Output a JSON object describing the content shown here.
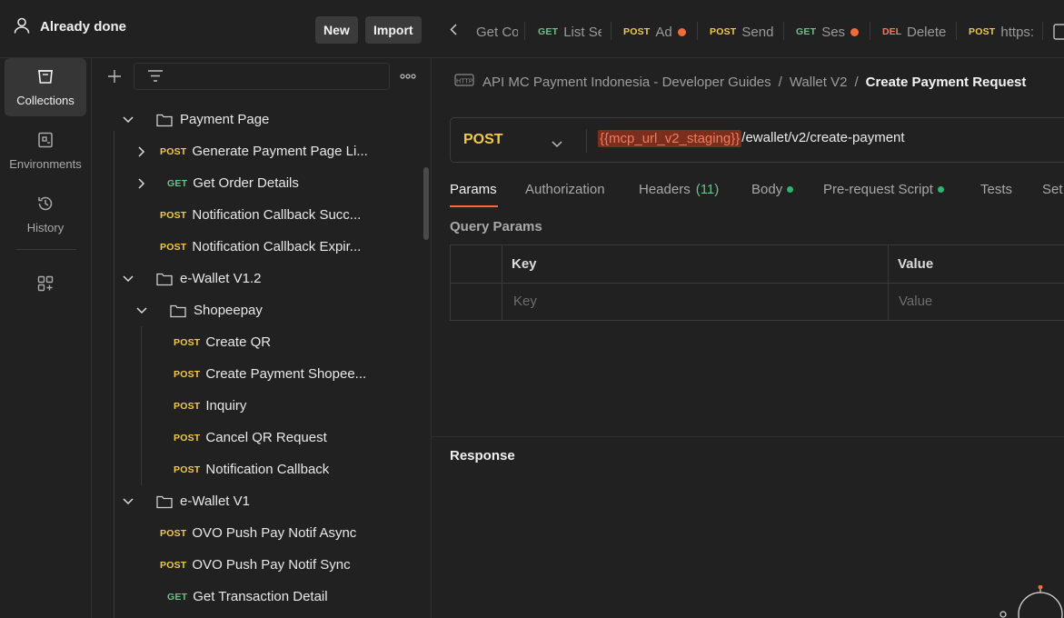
{
  "workspace": {
    "name": "Already done",
    "new_label": "New",
    "import_label": "Import"
  },
  "rail": {
    "items": [
      {
        "label": "Collections",
        "icon": "collections-icon"
      },
      {
        "label": "Environments",
        "icon": "environments-icon"
      },
      {
        "label": "History",
        "icon": "history-icon"
      }
    ]
  },
  "tree": {
    "rows": [
      {
        "type": "folder",
        "label": "Payment Page"
      },
      {
        "method": "POST",
        "label": "Generate Payment Page Li..."
      },
      {
        "method": "GET",
        "label": "Get Order Details"
      },
      {
        "method": "POST",
        "label": "Notification Callback Succ..."
      },
      {
        "method": "POST",
        "label": "Notification Callback Expir..."
      },
      {
        "type": "folder",
        "label": "e-Wallet V1.2"
      },
      {
        "type": "folder",
        "label": "Shopeepay"
      },
      {
        "method": "POST",
        "label": "Create QR"
      },
      {
        "method": "POST",
        "label": "Create Payment Shopee..."
      },
      {
        "method": "POST",
        "label": "Inquiry"
      },
      {
        "method": "POST",
        "label": "Cancel QR Request"
      },
      {
        "method": "POST",
        "label": "Notification Callback"
      },
      {
        "type": "folder",
        "label": "e-Wallet V1"
      },
      {
        "method": "POST",
        "label": "OVO Push Pay Notif Async"
      },
      {
        "method": "POST",
        "label": "OVO Push Pay Notif Sync"
      },
      {
        "method": "GET",
        "label": "Get Transaction Detail"
      }
    ]
  },
  "tabs": [
    {
      "method": "",
      "label": "Get Co"
    },
    {
      "method": "GET",
      "label": "List Se"
    },
    {
      "method": "POST",
      "label": "Ad"
    },
    {
      "method": "POST",
      "label": "Send"
    },
    {
      "method": "GET",
      "label": "Ses"
    },
    {
      "method": "DEL",
      "label": "Delete"
    },
    {
      "method": "POST",
      "label": "https:"
    }
  ],
  "breadcrumb": {
    "collection": "API MC Payment Indonesia - Developer Guides",
    "sep": "/",
    "folder": "Wallet V2",
    "current": "Create Payment Request"
  },
  "request": {
    "method": "POST",
    "url_var": "{{mcp_url_v2_staging}}",
    "url_path": "/ewallet/v2/create-payment"
  },
  "subtabs": {
    "params": "Params",
    "authorization": "Authorization",
    "headers": "Headers",
    "headers_count": "(11)",
    "body": "Body",
    "prerequest": "Pre-request Script",
    "tests": "Tests",
    "settings": "Set"
  },
  "params": {
    "title": "Query Params",
    "key_header": "Key",
    "value_header": "Value",
    "key_placeholder": "Key",
    "value_placeholder": "Value"
  },
  "response": {
    "title": "Response"
  },
  "colors": {
    "post": "#f2c94c",
    "get": "#6bc287",
    "del": "#f07b6b",
    "accent": "#f26b3a"
  }
}
